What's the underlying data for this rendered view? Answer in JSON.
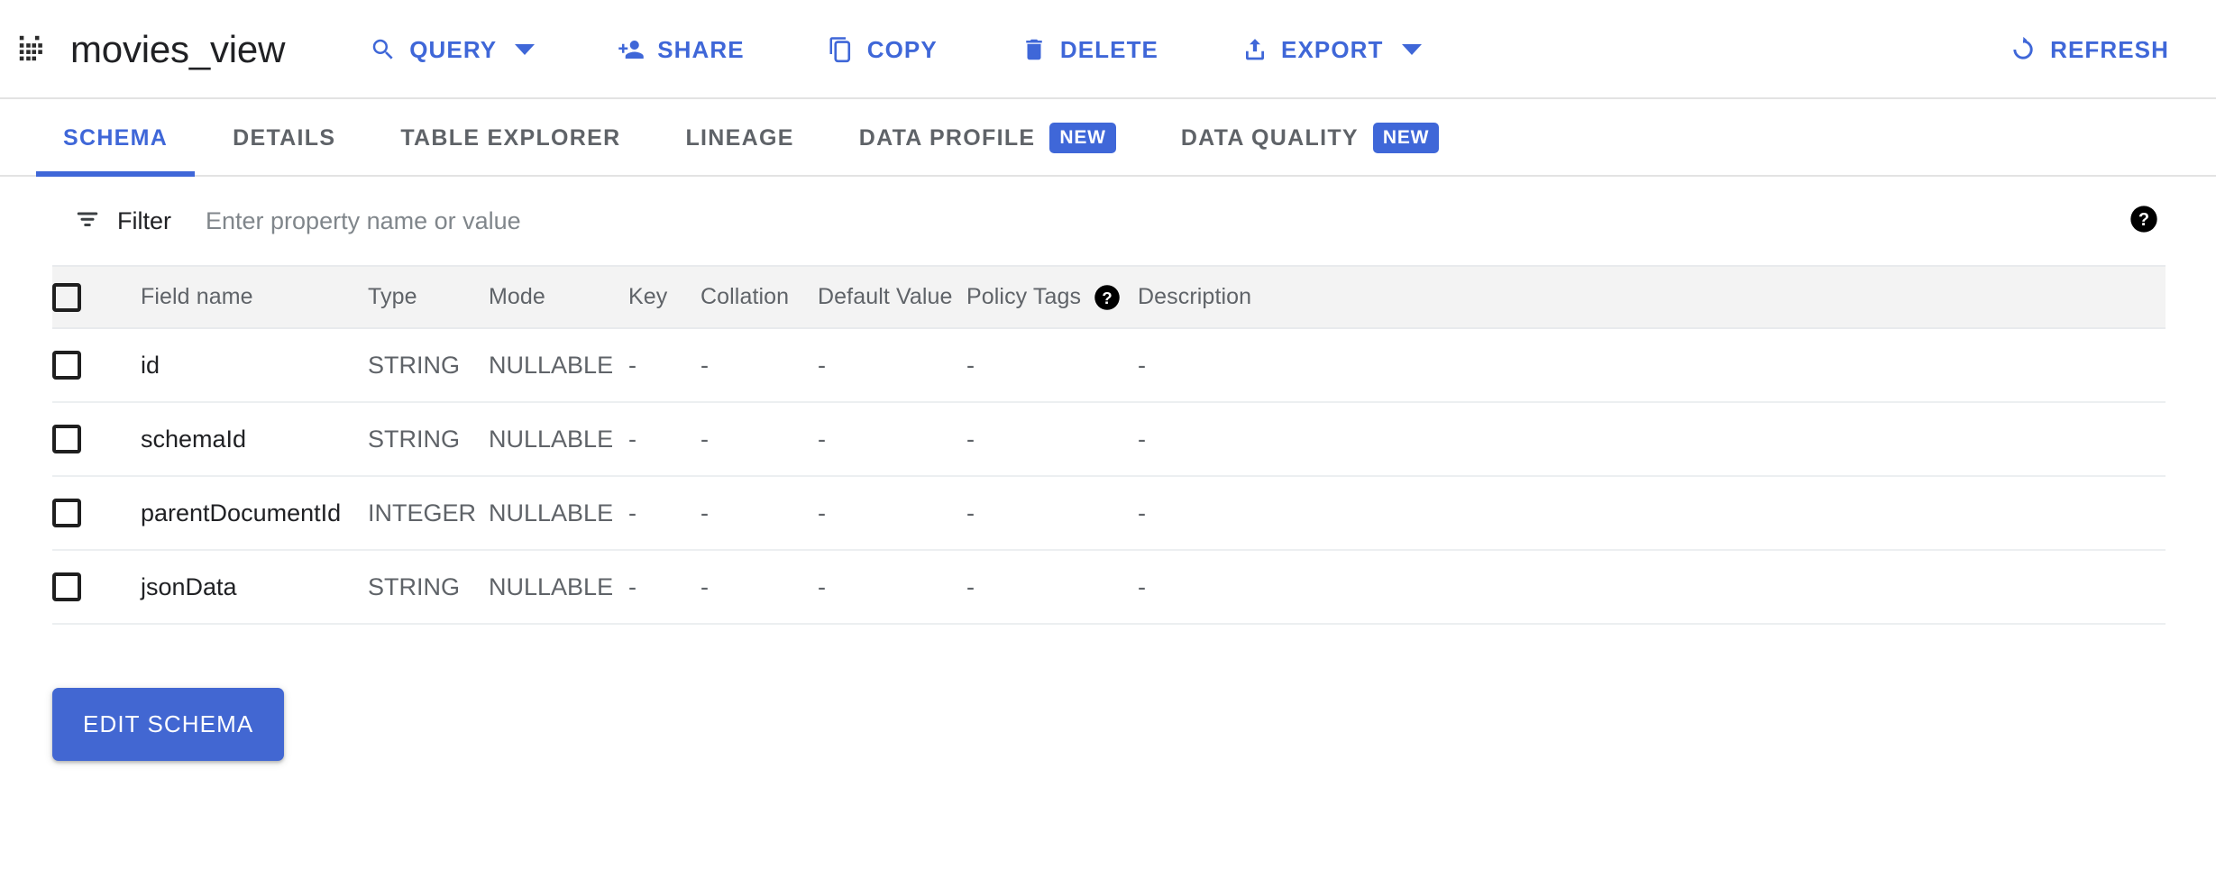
{
  "header": {
    "apps_icon": "apps-grid-icon",
    "title": "movies_view",
    "actions": [
      {
        "id": "query",
        "label": "QUERY",
        "icon": "search-icon",
        "has_caret": true
      },
      {
        "id": "share",
        "label": "SHARE",
        "icon": "person-add-icon",
        "has_caret": false
      },
      {
        "id": "copy",
        "label": "COPY",
        "icon": "copy-icon",
        "has_caret": false
      },
      {
        "id": "delete",
        "label": "DELETE",
        "icon": "trash-icon",
        "has_caret": false
      },
      {
        "id": "export",
        "label": "EXPORT",
        "icon": "upload-icon",
        "has_caret": true
      },
      {
        "id": "refresh",
        "label": "REFRESH",
        "icon": "refresh-icon",
        "has_caret": false
      }
    ],
    "accent_color": "#3f67d8"
  },
  "tabs": [
    {
      "label": "SCHEMA",
      "active": true,
      "badge": null
    },
    {
      "label": "DETAILS",
      "active": false,
      "badge": null
    },
    {
      "label": "TABLE EXPLORER",
      "active": false,
      "badge": null
    },
    {
      "label": "LINEAGE",
      "active": false,
      "badge": null
    },
    {
      "label": "DATA PROFILE",
      "active": false,
      "badge": "NEW"
    },
    {
      "label": "DATA QUALITY",
      "active": false,
      "badge": "NEW"
    }
  ],
  "filter": {
    "label": "Filter",
    "placeholder": "Enter property name or value",
    "value": "",
    "help_icon": "help-circle-icon"
  },
  "table": {
    "columns": [
      "Field name",
      "Type",
      "Mode",
      "Key",
      "Collation",
      "Default Value",
      "Policy Tags",
      "Description"
    ],
    "policy_tags_help_icon": "help-circle-icon",
    "rows": [
      {
        "field_name": "id",
        "type": "STRING",
        "mode": "NULLABLE",
        "key": "-",
        "collation": "-",
        "default_value": "-",
        "policy_tags": "-",
        "description": "-",
        "checked": false
      },
      {
        "field_name": "schemaId",
        "type": "STRING",
        "mode": "NULLABLE",
        "key": "-",
        "collation": "-",
        "default_value": "-",
        "policy_tags": "-",
        "description": "-",
        "checked": false
      },
      {
        "field_name": "parentDocumentId",
        "type": "INTEGER",
        "mode": "NULLABLE",
        "key": "-",
        "collation": "-",
        "default_value": "-",
        "policy_tags": "-",
        "description": "-",
        "checked": false
      },
      {
        "field_name": "jsonData",
        "type": "STRING",
        "mode": "NULLABLE",
        "key": "-",
        "collation": "-",
        "default_value": "-",
        "policy_tags": "-",
        "description": "-",
        "checked": false
      }
    ]
  },
  "footer": {
    "edit_schema_label": "EDIT SCHEMA",
    "edit_schema_color": "#4267d2"
  }
}
